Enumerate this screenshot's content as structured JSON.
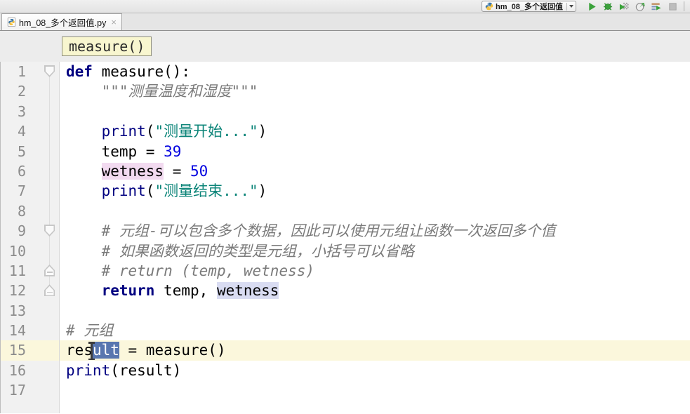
{
  "colors": {
    "keyword": "#000080",
    "string": "#0B8478",
    "number": "#0000E0",
    "comment": "#7A7A7A",
    "selection_bg": "#5876AF",
    "current_line_bg": "#FBF7DC",
    "occurrence_write_bg": "#F2DAF0",
    "occurrence_read_bg": "#D9DCF2",
    "run_green": "#3BA23B",
    "hint_bg": "#F8F6CF"
  },
  "toolbar": {
    "run_config_label": "hm_08_多个返回值",
    "icons": [
      {
        "name": "run-icon"
      },
      {
        "name": "debug-icon"
      },
      {
        "name": "run-with-coverage-icon"
      },
      {
        "name": "profiler-icon"
      },
      {
        "name": "concurrency-diagram-icon"
      },
      {
        "name": "stop-icon"
      }
    ]
  },
  "tabbar": {
    "tabs": [
      {
        "label": "hm_08_多个返回值.py",
        "close_glyph": "×"
      }
    ]
  },
  "context_hint": {
    "text": "measure()"
  },
  "editor": {
    "lines": [
      {
        "n": 1,
        "fold": "down",
        "tokens": [
          {
            "t": "def",
            "c": "kw"
          },
          {
            "t": " measure():",
            "c": "txt"
          }
        ]
      },
      {
        "n": 2,
        "tokens": [
          {
            "t": "    ",
            "c": "txt"
          },
          {
            "t": "\"\"\"测量温度和湿度\"\"\"",
            "c": "com"
          }
        ]
      },
      {
        "n": 3,
        "tokens": []
      },
      {
        "n": 4,
        "tokens": [
          {
            "t": "    ",
            "c": "txt"
          },
          {
            "t": "print",
            "c": "pr"
          },
          {
            "t": "(",
            "c": "txt"
          },
          {
            "t": "\"测量开始...\"",
            "c": "str"
          },
          {
            "t": ")",
            "c": "txt"
          }
        ]
      },
      {
        "n": 5,
        "tokens": [
          {
            "t": "    temp = ",
            "c": "txt"
          },
          {
            "t": "39",
            "c": "num"
          }
        ]
      },
      {
        "n": 6,
        "tokens": [
          {
            "t": "    ",
            "c": "txt"
          },
          {
            "t": "wetness",
            "c": "txt",
            "hl": "pink"
          },
          {
            "t": " = ",
            "c": "txt"
          },
          {
            "t": "50",
            "c": "num"
          }
        ]
      },
      {
        "n": 7,
        "tokens": [
          {
            "t": "    ",
            "c": "txt"
          },
          {
            "t": "print",
            "c": "pr"
          },
          {
            "t": "(",
            "c": "txt"
          },
          {
            "t": "\"测量结束...\"",
            "c": "str"
          },
          {
            "t": ")",
            "c": "txt"
          }
        ]
      },
      {
        "n": 8,
        "tokens": []
      },
      {
        "n": 9,
        "fold": "down",
        "tokens": [
          {
            "t": "    ",
            "c": "txt"
          },
          {
            "t": "# 元组-可以包含多个数据，因此可以使用元组让函数一次返回多个值",
            "c": "com"
          }
        ]
      },
      {
        "n": 10,
        "tokens": [
          {
            "t": "    ",
            "c": "txt"
          },
          {
            "t": "# 如果函数返回的类型是元组，小括号可以省略",
            "c": "com"
          }
        ]
      },
      {
        "n": 11,
        "fold": "up",
        "tokens": [
          {
            "t": "    ",
            "c": "txt"
          },
          {
            "t": "# return (temp, wetness)",
            "c": "com"
          }
        ]
      },
      {
        "n": 12,
        "fold": "up",
        "tokens": [
          {
            "t": "    ",
            "c": "txt"
          },
          {
            "t": "return",
            "c": "kw"
          },
          {
            "t": " temp, ",
            "c": "txt"
          },
          {
            "t": "wetness",
            "c": "txt",
            "hl": "lav"
          }
        ]
      },
      {
        "n": 13,
        "tokens": []
      },
      {
        "n": 14,
        "tokens": [
          {
            "t": "# 元组",
            "c": "com"
          }
        ]
      },
      {
        "n": 15,
        "current": true,
        "tokens": [
          {
            "t": "res",
            "c": "txt"
          },
          {
            "t": "ult",
            "c": "sel"
          },
          {
            "t": " = measure()",
            "c": "txt"
          }
        ]
      },
      {
        "n": 16,
        "tokens": [
          {
            "t": "print",
            "c": "pr"
          },
          {
            "t": "(result)",
            "c": "txt"
          }
        ]
      },
      {
        "n": 17,
        "tokens": []
      }
    ]
  }
}
